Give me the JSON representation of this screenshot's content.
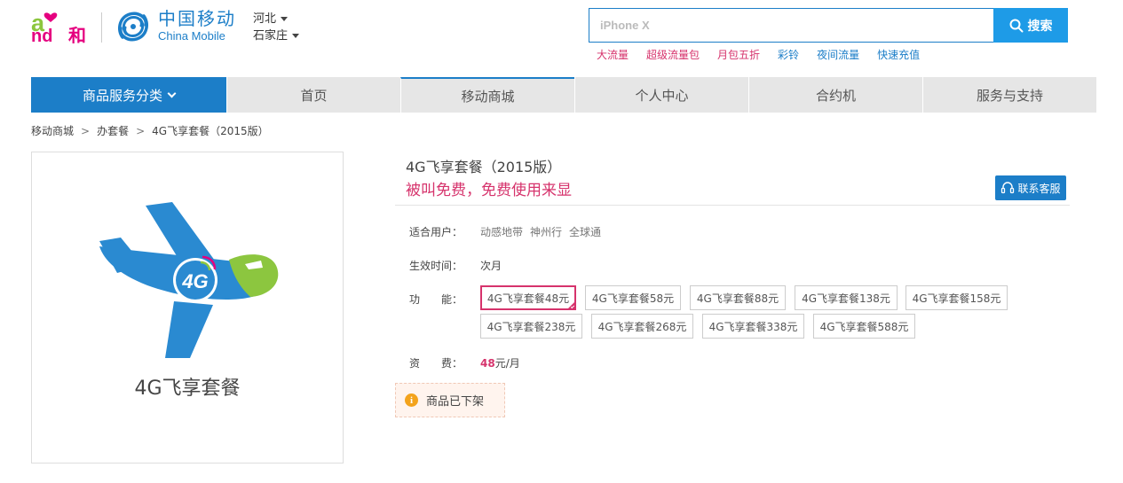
{
  "header": {
    "brand_en": "China Mobile",
    "brand_cn": "中国移动",
    "and_logo": {
      "a": "a",
      "nd": "nd",
      "he": "和"
    },
    "region": {
      "province": "河北",
      "city": "石家庄"
    },
    "search": {
      "placeholder": "iPhone X",
      "button_label": "搜索"
    },
    "hot_links": [
      {
        "label": "大流量",
        "color": "#d6336c"
      },
      {
        "label": "超级流量包",
        "color": "#d6336c"
      },
      {
        "label": "月包五折",
        "color": "#d6336c"
      },
      {
        "label": "彩铃",
        "color": "#1c7ec8"
      },
      {
        "label": "夜间流量",
        "color": "#1c7ec8"
      },
      {
        "label": "快速充值",
        "color": "#1c7ec8"
      }
    ]
  },
  "nav": {
    "category": "商品服务分类",
    "items": [
      "首页",
      "移动商城",
      "个人中心",
      "合约机",
      "服务与支持"
    ]
  },
  "breadcrumb": [
    "移动商城",
    "办套餐",
    "4G飞享套餐（2015版）"
  ],
  "product": {
    "image_caption": "4G飞享套餐",
    "image_badge": "4G",
    "title": "4G飞享套餐（2015版）",
    "subtitle": "被叫免费，免费使用来显",
    "contact_label": "联系客服",
    "users_label": "适合用户：",
    "users": [
      "动感地带",
      "神州行",
      "全球通"
    ],
    "effective_label": "生效时间：",
    "effective_value": "次月",
    "features_label": "功　　能：",
    "options": [
      "4G飞享套餐48元",
      "4G飞享套餐58元",
      "4G飞享套餐88元",
      "4G飞享套餐138元",
      "4G飞享套餐158元",
      "4G飞享套餐238元",
      "4G飞享套餐268元",
      "4G飞享套餐338元",
      "4G飞享套餐588元"
    ],
    "selected_option": 0,
    "price_label": "资　　费：",
    "price_value": "48",
    "price_unit": "元/月",
    "notice": "商品已下架",
    "notice_icon": "i"
  },
  "colors": {
    "brand_blue": "#1c7ec8",
    "search_blue": "#1e9be7",
    "accent_pink": "#d6336c",
    "plane_blue": "#2a8ad1",
    "plane_green": "#8cc63f"
  }
}
